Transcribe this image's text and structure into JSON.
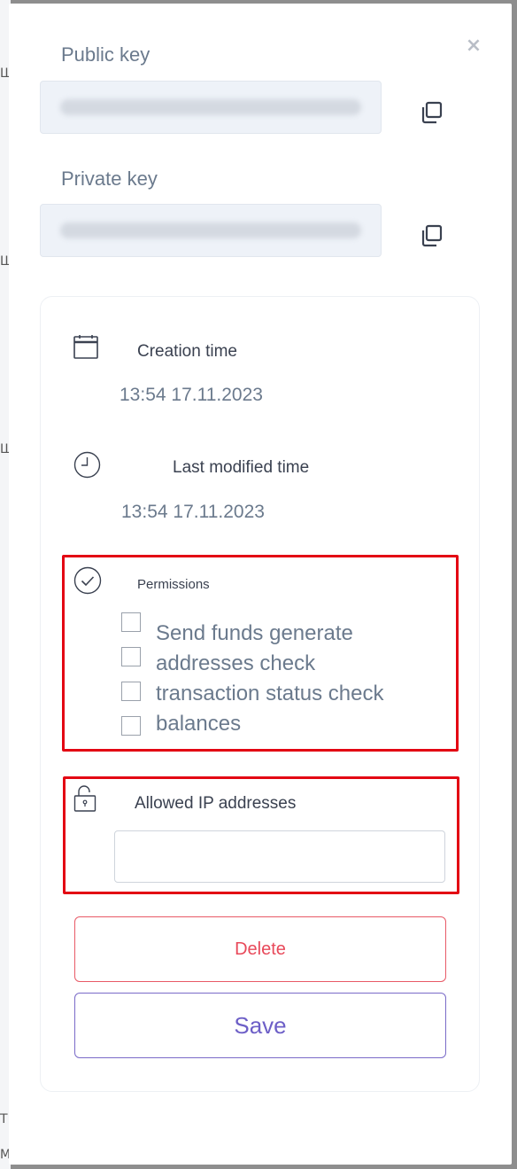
{
  "dialog": {
    "close_glyph": "×",
    "public_key": {
      "label": "Public key",
      "value_masked": "",
      "copy_icon": "copy-icon"
    },
    "private_key": {
      "label": "Private key",
      "value_masked": "",
      "copy_icon": "copy-icon"
    },
    "creation": {
      "title": "Creation time",
      "value": "13:54 17.11.2023",
      "icon": "calendar-icon"
    },
    "modified": {
      "title": "Last modified time",
      "value": "13:54 17.11.2023",
      "icon": "clock-icon"
    },
    "permissions": {
      "title": "Permissions",
      "icon": "check-circle-icon",
      "lines": [
        "Send funds generate",
        "addresses check",
        "transaction status check",
        "balances"
      ],
      "checked": [
        false,
        false,
        false,
        false
      ]
    },
    "allowed_ip": {
      "title": "Allowed IP addresses",
      "value": "",
      "placeholder": "",
      "icon": "unlock-icon"
    },
    "buttons": {
      "delete": "Delete",
      "save": "Save"
    }
  },
  "colors": {
    "highlight": "#e30613",
    "delete": "#e8495a",
    "save": "#6d5fc7",
    "muted_text": "#6b7a8d"
  }
}
